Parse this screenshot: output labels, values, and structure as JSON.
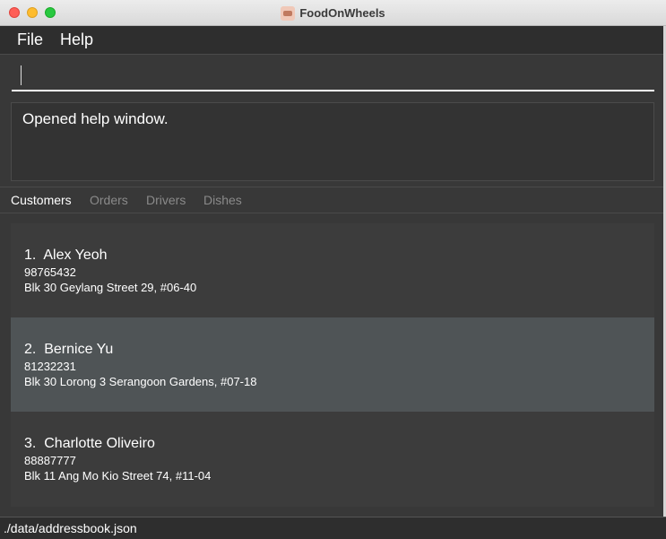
{
  "window": {
    "title": "FoodOnWheels",
    "app_icon": "food-truck-icon"
  },
  "menu": {
    "items": [
      {
        "label": "File"
      },
      {
        "label": "Help"
      }
    ]
  },
  "command": {
    "value": "",
    "placeholder": ""
  },
  "result": {
    "text": "Opened help window."
  },
  "tabs": [
    {
      "label": "Customers",
      "active": true
    },
    {
      "label": "Orders",
      "active": false
    },
    {
      "label": "Drivers",
      "active": false
    },
    {
      "label": "Dishes",
      "active": false
    }
  ],
  "customers": [
    {
      "index": "1.",
      "name": "Alex Yeoh",
      "phone": "98765432",
      "address": "Blk 30 Geylang Street 29, #06-40",
      "selected": false
    },
    {
      "index": "2.",
      "name": "Bernice Yu",
      "phone": "81232231",
      "address": "Blk 30 Lorong 3 Serangoon Gardens, #07-18",
      "selected": true
    },
    {
      "index": "3.",
      "name": "Charlotte Oliveiro",
      "phone": "88887777",
      "address": "Blk 11 Ang Mo Kio Street 74, #11-04",
      "selected": false
    }
  ],
  "status": {
    "path": "./data/addressbook.json"
  },
  "colors": {
    "background": "#383838",
    "selected_row": "#4f5456",
    "close": "#fe5f57",
    "minimize": "#febc2e",
    "maximize": "#28c840"
  }
}
